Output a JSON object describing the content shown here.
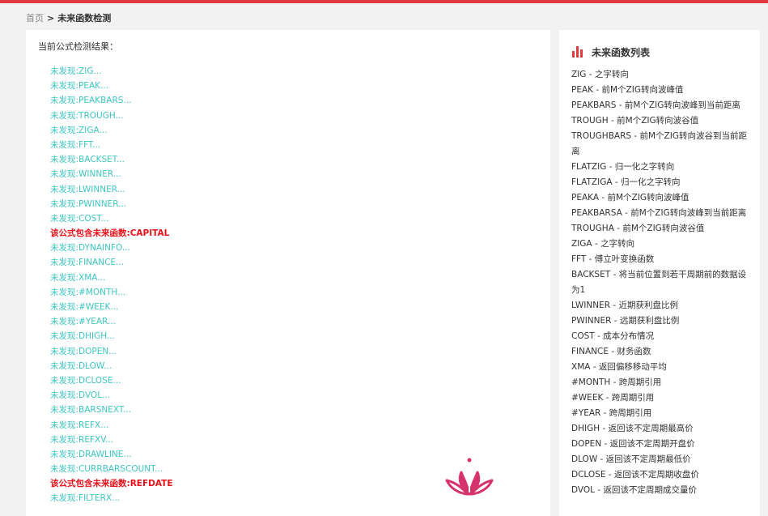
{
  "breadcrumb": {
    "home": "首页",
    "separator": ">",
    "current": "未来函数检测"
  },
  "main": {
    "title": "当前公式检测结果：",
    "results": [
      {
        "text": "未发现:ZIG...",
        "found": false
      },
      {
        "text": "未发现:PEAK...",
        "found": false
      },
      {
        "text": "未发现:PEAKBARS...",
        "found": false
      },
      {
        "text": "未发现:TROUGH...",
        "found": false
      },
      {
        "text": "未发现:ZIGA...",
        "found": false
      },
      {
        "text": "未发现:FFT...",
        "found": false
      },
      {
        "text": "未发现:BACKSET...",
        "found": false
      },
      {
        "text": "未发现:WINNER...",
        "found": false
      },
      {
        "text": "未发现:LWINNER...",
        "found": false
      },
      {
        "text": "未发现:PWINNER...",
        "found": false
      },
      {
        "text": "未发现:COST...",
        "found": false
      },
      {
        "text": "该公式包含未来函数:CAPITAL",
        "found": true
      },
      {
        "text": "未发现:DYNAINFO...",
        "found": false
      },
      {
        "text": "未发现:FINANCE...",
        "found": false
      },
      {
        "text": "未发现:XMA...",
        "found": false
      },
      {
        "text": "未发现:#MONTH...",
        "found": false
      },
      {
        "text": "未发现:#WEEK...",
        "found": false
      },
      {
        "text": "未发现:#YEAR...",
        "found": false
      },
      {
        "text": "未发现:DHIGH...",
        "found": false
      },
      {
        "text": "未发现:DOPEN...",
        "found": false
      },
      {
        "text": "未发现:DLOW...",
        "found": false
      },
      {
        "text": "未发现:DCLOSE...",
        "found": false
      },
      {
        "text": "未发现:DVOL...",
        "found": false
      },
      {
        "text": "未发现:BARSNEXT...",
        "found": false
      },
      {
        "text": "未发现:REFX...",
        "found": false
      },
      {
        "text": "未发现:REFXV...",
        "found": false
      },
      {
        "text": "未发现:DRAWLINE...",
        "found": false
      },
      {
        "text": "未发现:CURRBARSCOUNT...",
        "found": false
      },
      {
        "text": "该公式包含未来函数:REFDATE",
        "found": true
      },
      {
        "text": "未发现:FILTERX...",
        "found": false
      }
    ]
  },
  "sidebar": {
    "title": "未来函数列表",
    "icon": "bar-chart-icon",
    "items": [
      "ZIG - 之字转向",
      "PEAK - 前M个ZIG转向波峰值",
      "PEAKBARS - 前M个ZIG转向波峰到当前距离",
      "TROUGH - 前M个ZIG转向波谷值",
      "TROUGHBARS - 前M个ZIG转向波谷到当前距离",
      "FLATZIG - 归一化之字转向",
      "FLATZIGA - 归一化之字转向",
      "PEAKA - 前M个ZIG转向波峰值",
      "PEAKBARSA - 前M个ZIG转向波峰到当前距离",
      "TROUGHA - 前M个ZIG转向波谷值",
      "ZIGA - 之字转向",
      "FFT - 傅立叶变换函数",
      "BACKSET - 将当前位置到若干周期前的数据设为1",
      "LWINNER - 近期获利盘比例",
      "PWINNER - 远期获利盘比例",
      "COST - 成本分布情况",
      "FINANCE - 财务函数",
      "XMA - 返回偏移移动平均",
      "#MONTH - 跨周期引用",
      "#WEEK - 跨周期引用",
      "#YEAR - 跨周期引用",
      "DHIGH - 返回该不定周期最高价",
      "DOPEN - 返回该不定周期开盘价",
      "DLOW - 返回该不定周期最低价",
      "DCLOSE - 返回该不定周期收盘价",
      "DVOL - 返回该不定周期成交量价"
    ]
  },
  "colors": {
    "accent": "#e0393e",
    "not_found": "#3ec6c0",
    "found": "#e8121a",
    "logo": "#d6336c"
  }
}
